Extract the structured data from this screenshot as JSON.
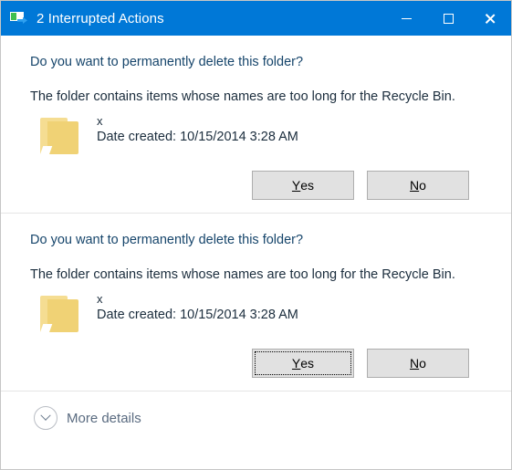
{
  "window": {
    "title": "2 Interrupted Actions",
    "icon": "file-move-icon",
    "accent_color": "#0078D7",
    "background_color": "#FFFFFF",
    "controls": {
      "minimize_label": "Minimize",
      "maximize_label": "Maximize",
      "close_label": "Close"
    }
  },
  "dialogs": [
    {
      "heading": "Do you want to permanently delete this folder?",
      "description": "The folder contains items whose names are too long for the Recycle Bin.",
      "item": {
        "icon": "folder-icon",
        "name": "x",
        "date": "Date created: 10/15/2014 3:28 AM"
      },
      "buttons": {
        "yes": {
          "accel": "Y",
          "rest": "es",
          "focused": false
        },
        "no": {
          "accel": "N",
          "rest": "o",
          "focused": false
        }
      }
    },
    {
      "heading": "Do you want to permanently delete this folder?",
      "description": "The folder contains items whose names are too long for the Recycle Bin.",
      "item": {
        "icon": "folder-icon",
        "name": "x",
        "date": "Date created: 10/15/2014 3:28 AM"
      },
      "buttons": {
        "yes": {
          "accel": "Y",
          "rest": "es",
          "focused": true
        },
        "no": {
          "accel": "N",
          "rest": "o",
          "focused": false
        }
      }
    }
  ],
  "footer": {
    "more_details_label": "More details",
    "chevron_icon": "chevron-down-icon",
    "text_color": "#5A6B80"
  }
}
